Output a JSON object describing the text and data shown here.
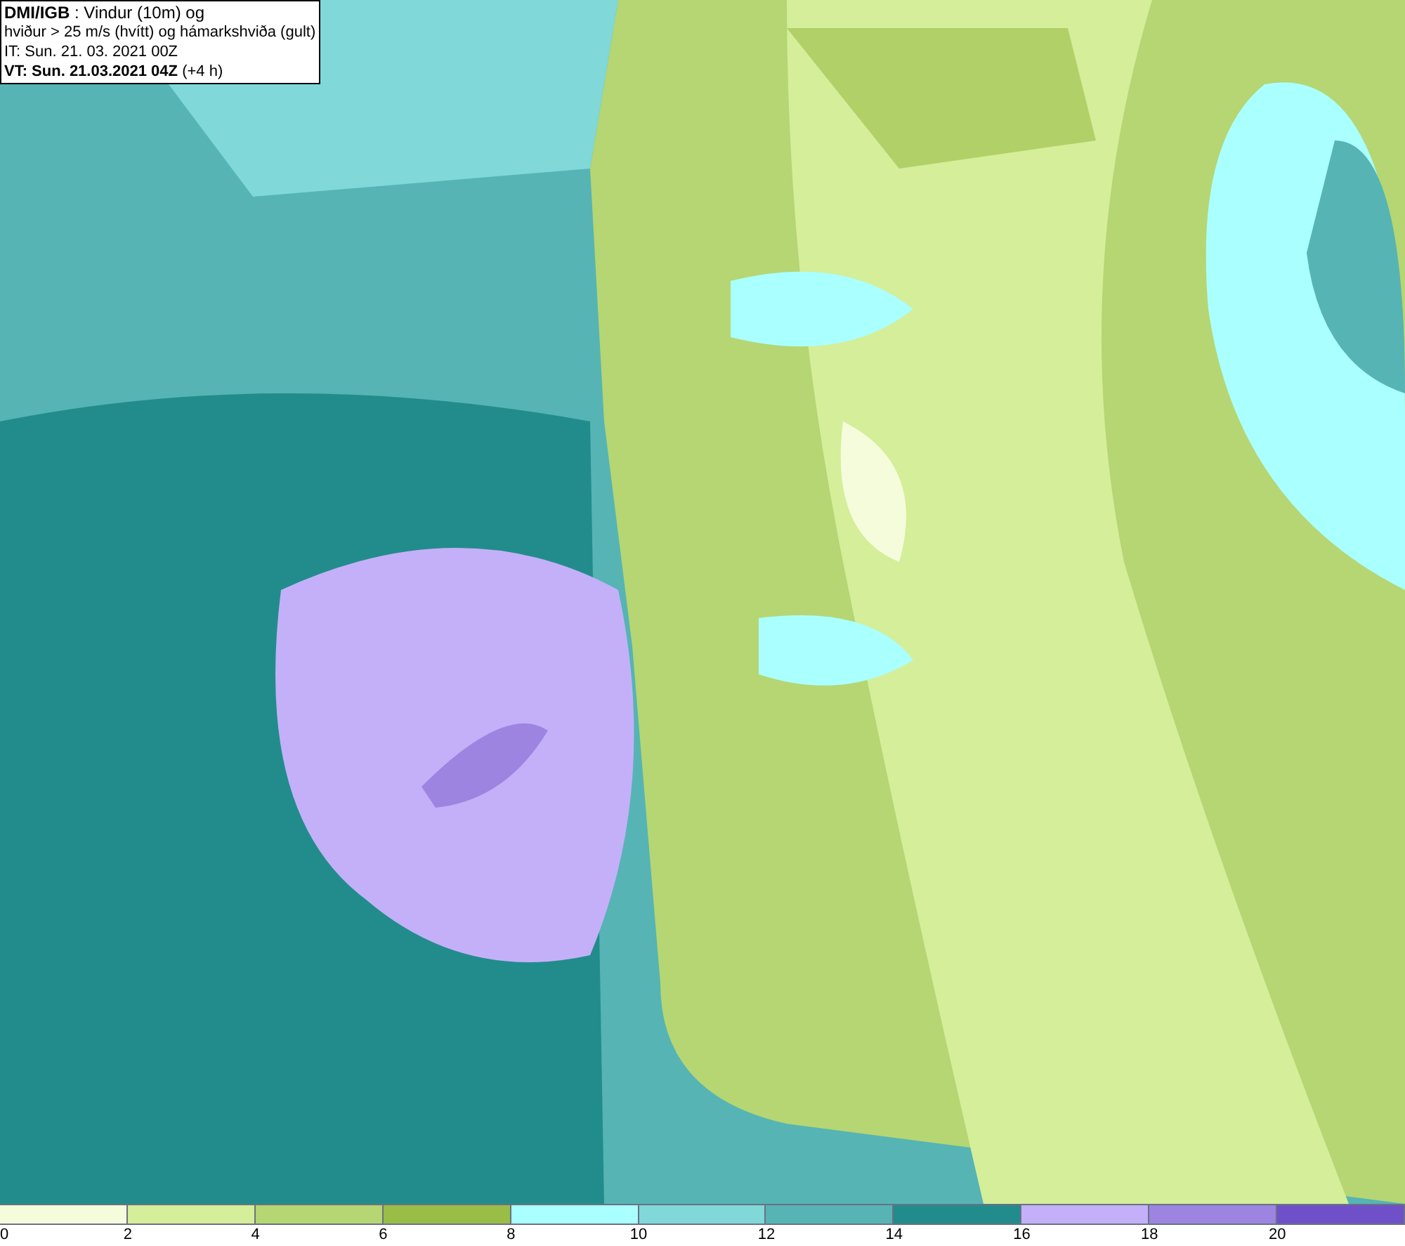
{
  "header": {
    "lines": [
      "**DMI/IGB** : Vindur (10m) og",
      "hviður > 25 m/s (hvítt) og hámarkshviða (gult)",
      "IT: Sun. 21. 03. 2021 00Z",
      "**VT: Sun. 21.03.2021 04Z** (+4 h)"
    ]
  },
  "legend": {
    "segments": [
      {
        "color": "#f5fcdc"
      },
      {
        "color": "#d4ee9a"
      },
      {
        "color": "#b5d672"
      },
      {
        "color": "#9abd48"
      },
      {
        "color": "#aaffff"
      },
      {
        "color": "#80d8d8"
      },
      {
        "color": "#56b4b4"
      },
      {
        "color": "#228c8c"
      },
      {
        "color": "#c4b0f8"
      },
      {
        "color": "#9c84e0"
      },
      {
        "color": "#7050c8"
      }
    ],
    "labels": [
      "0",
      "2",
      "4",
      "6",
      "8",
      "10",
      "12",
      "14",
      "16",
      "18",
      "20"
    ]
  }
}
